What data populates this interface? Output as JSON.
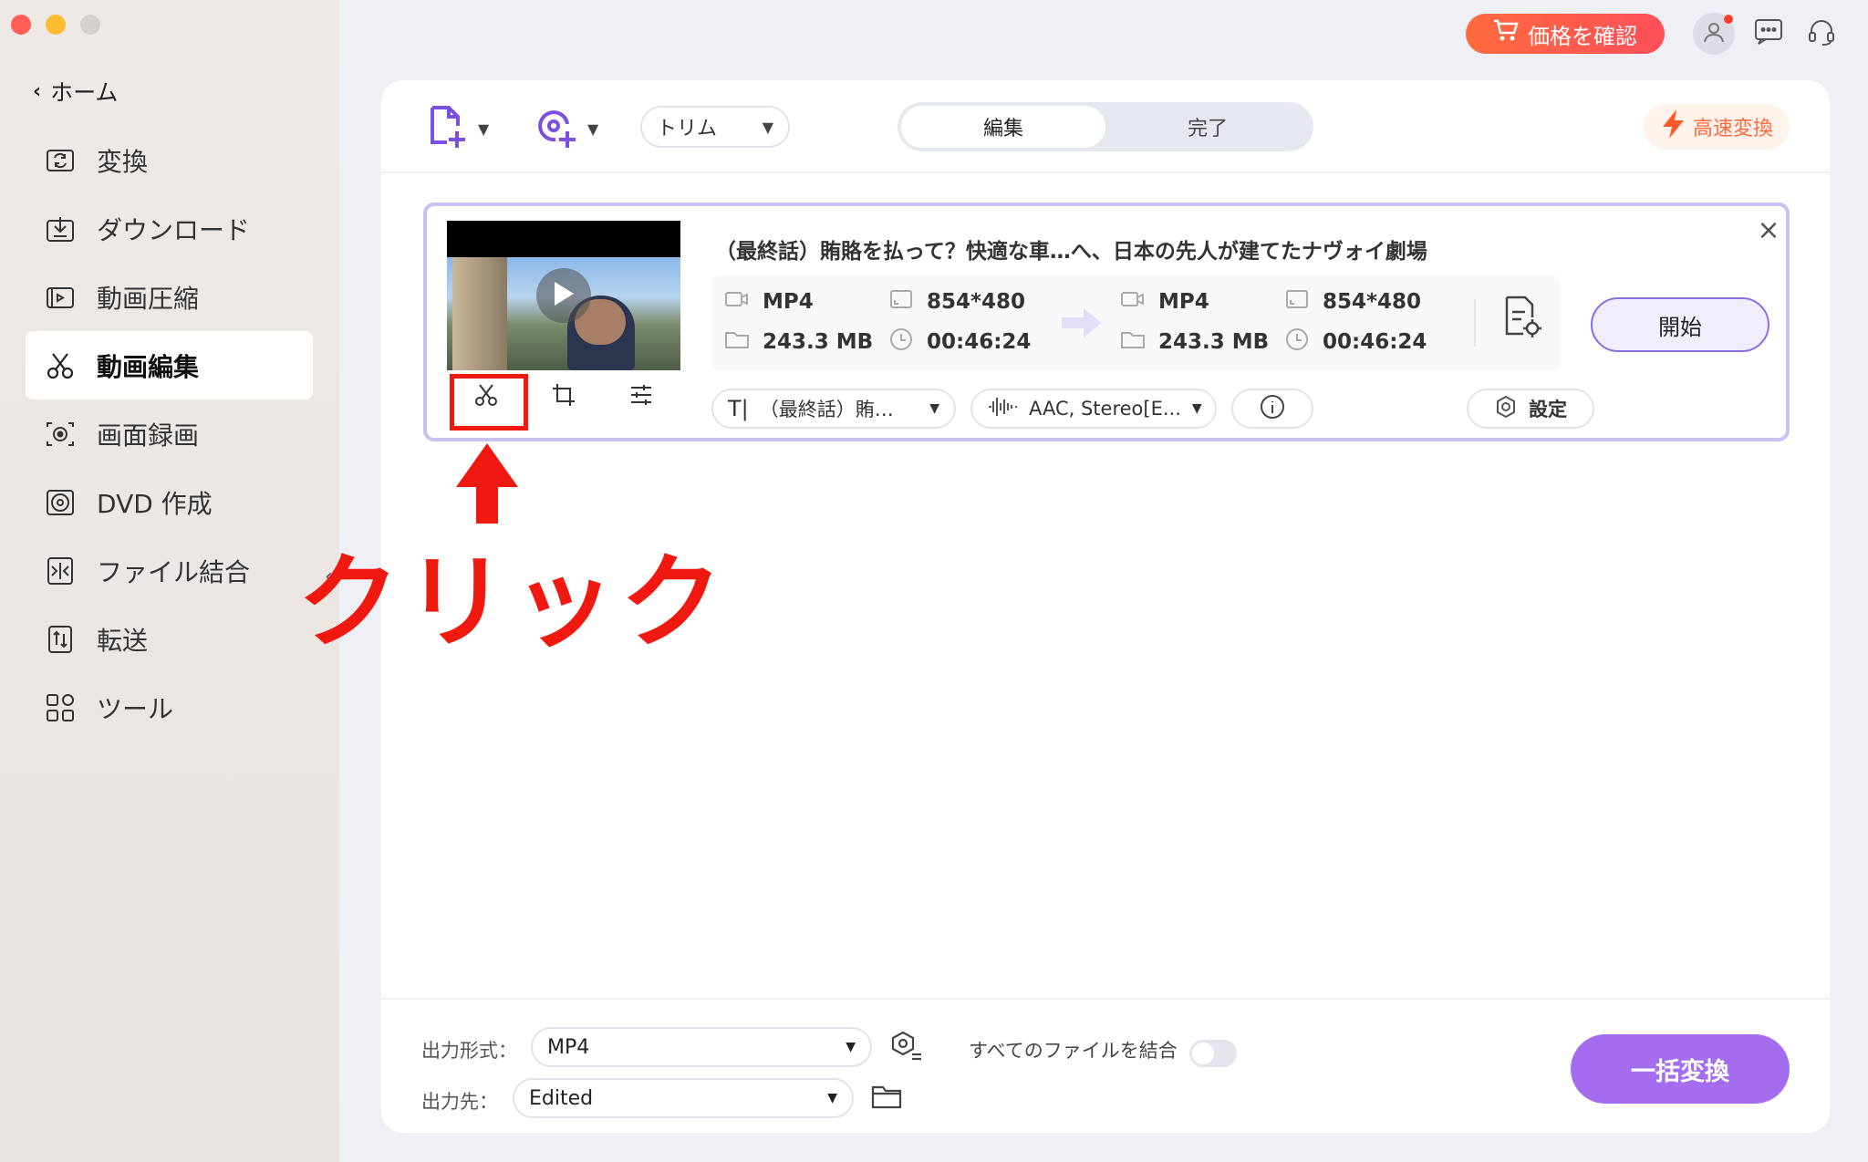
{
  "sidebar": {
    "home": "ホーム",
    "items": [
      {
        "label": "変換",
        "icon": "convert-icon"
      },
      {
        "label": "ダウンロード",
        "icon": "download-icon"
      },
      {
        "label": "動画圧縮",
        "icon": "compress-icon"
      },
      {
        "label": "動画編集",
        "icon": "scissors-icon",
        "active": true
      },
      {
        "label": "画面録画",
        "icon": "screen-record-icon"
      },
      {
        "label": "DVD 作成",
        "icon": "dvd-icon"
      },
      {
        "label": "ファイル結合",
        "icon": "merge-icon"
      },
      {
        "label": "転送",
        "icon": "transfer-icon"
      },
      {
        "label": "ツール",
        "icon": "tools-icon"
      }
    ]
  },
  "header": {
    "price_button": "価格を確認"
  },
  "toolbar": {
    "trim_select": "トリム",
    "tabs": [
      "編集",
      "完了"
    ],
    "fast_convert": "高速変換"
  },
  "file": {
    "title": "（最終話）賄賂を払って？快適な車…へ、日本の先人が建てたナヴォイ劇場",
    "source": {
      "format": "MP4",
      "resolution": "854*480",
      "size": "243.3 MB",
      "duration": "00:46:24"
    },
    "target": {
      "format": "MP4",
      "resolution": "854*480",
      "size": "243.3 MB",
      "duration": "00:46:24"
    },
    "start_button": "開始",
    "subtitle_select": "（最終話）賄…",
    "audio_select": "AAC, Stereo[E...",
    "settings_button": "設定"
  },
  "bottom": {
    "output_format_label": "出力形式：",
    "output_format_value": "MP4",
    "output_dest_label": "出力先：",
    "output_dest_value": "Edited",
    "merge_label": "すべてのファイルを結合",
    "convert_all": "一括変換"
  },
  "annotation": {
    "text": "クリック"
  },
  "colors": {
    "accent_purple": "#a46df0",
    "price_orange": "#ff5a45",
    "annotation_red": "#f0190f"
  }
}
